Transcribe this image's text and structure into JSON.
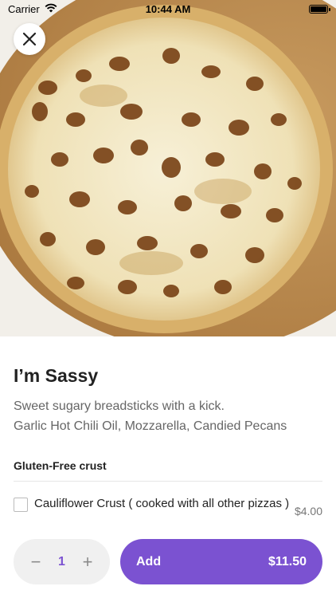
{
  "status_bar": {
    "carrier": "Carrier",
    "time": "10:44 AM",
    "wifi_icon": "wifi-icon",
    "battery_icon": "battery-icon"
  },
  "header": {
    "close_icon": "close-icon"
  },
  "item": {
    "title": "I’m Sassy",
    "description_line1": "Sweet sugary breadsticks with a kick.",
    "description_line2": "Garlic Hot Chili Oil, Mozzarella, Candied Pecans"
  },
  "options_section": {
    "title": "Gluten-Free crust",
    "options": [
      {
        "label": "Cauliflower Crust ( cooked with all other pizzas )",
        "price": "$4.00",
        "checked": false
      }
    ]
  },
  "cart": {
    "quantity": "1",
    "minus_label": "−",
    "plus_label": "+",
    "add_label": "Add",
    "total": "$11.50"
  },
  "colors": {
    "accent": "#7b52d1",
    "stepper_bg": "#f0f0f0"
  }
}
